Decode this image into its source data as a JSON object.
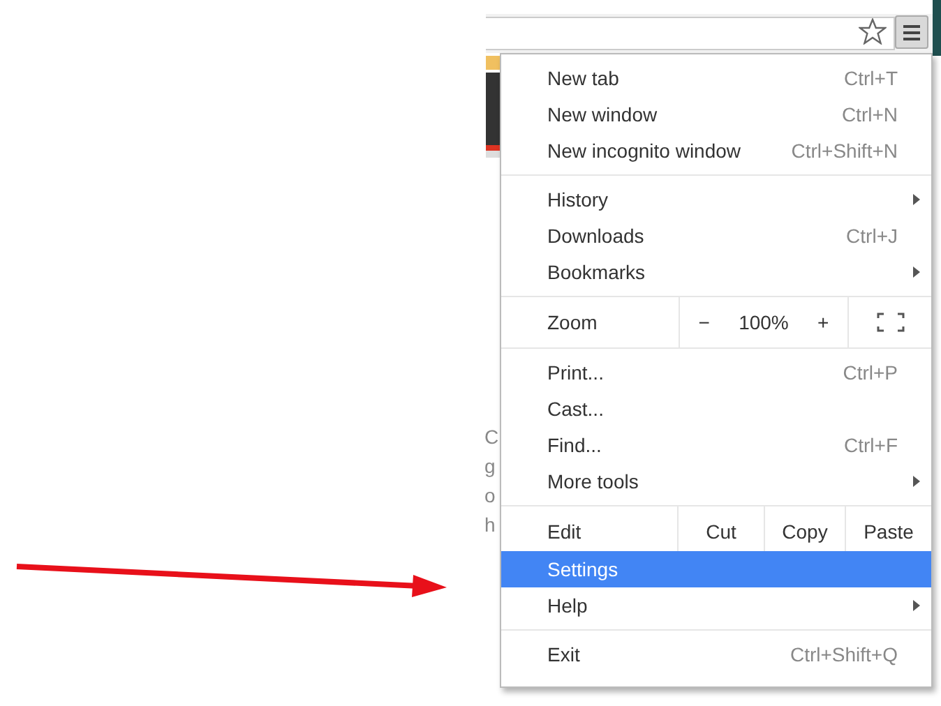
{
  "page_fragments": [
    "C",
    "g",
    "o",
    "h"
  ],
  "menu": {
    "sections": [
      {
        "items": [
          {
            "kind": "item",
            "label": "New tab",
            "shortcut": "Ctrl+T",
            "submenu": false,
            "selected": false
          },
          {
            "kind": "item",
            "label": "New window",
            "shortcut": "Ctrl+N",
            "submenu": false,
            "selected": false
          },
          {
            "kind": "item",
            "label": "New incognito window",
            "shortcut": "Ctrl+Shift+N",
            "submenu": false,
            "selected": false
          }
        ]
      },
      {
        "items": [
          {
            "kind": "item",
            "label": "History",
            "submenu": true,
            "selected": false
          },
          {
            "kind": "item",
            "label": "Downloads",
            "shortcut": "Ctrl+J",
            "submenu": false,
            "selected": false
          },
          {
            "kind": "item",
            "label": "Bookmarks",
            "submenu": true,
            "selected": false
          }
        ]
      },
      {
        "items": [
          {
            "kind": "zoom",
            "label": "Zoom",
            "minus": "−",
            "value": "100%",
            "plus": "+"
          }
        ]
      },
      {
        "items": [
          {
            "kind": "item",
            "label": "Print...",
            "shortcut": "Ctrl+P",
            "submenu": false,
            "selected": false
          },
          {
            "kind": "item",
            "label": "Cast...",
            "submenu": false,
            "selected": false
          },
          {
            "kind": "item",
            "label": "Find...",
            "shortcut": "Ctrl+F",
            "submenu": false,
            "selected": false
          },
          {
            "kind": "item",
            "label": "More tools",
            "submenu": true,
            "selected": false
          }
        ]
      },
      {
        "items": [
          {
            "kind": "edit",
            "label": "Edit",
            "buttons": [
              "Cut",
              "Copy",
              "Paste"
            ]
          },
          {
            "kind": "item",
            "label": "Settings",
            "submenu": false,
            "selected": true
          },
          {
            "kind": "item",
            "label": "Help",
            "submenu": true,
            "selected": false
          }
        ]
      },
      {
        "items": [
          {
            "kind": "item",
            "label": "Exit",
            "shortcut": "Ctrl+Shift+Q",
            "submenu": false,
            "selected": false
          }
        ]
      }
    ]
  }
}
